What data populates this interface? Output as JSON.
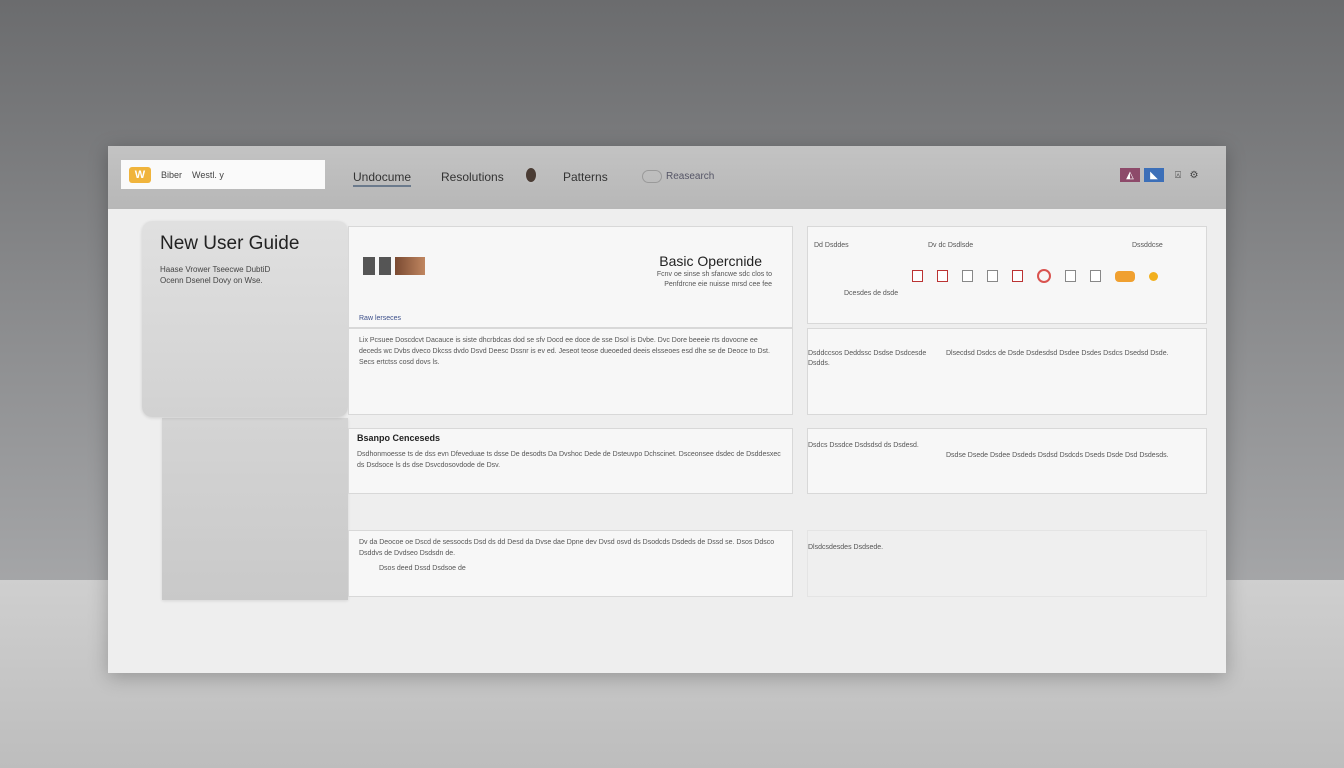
{
  "topbar": {
    "brand_logo": "logo-icon",
    "brand_text_a": "Biber",
    "brand_text_b": "Westl. y",
    "menu": [
      {
        "label": "Undocume"
      },
      {
        "label": "Resolutions"
      },
      {
        "label": "Patterns"
      }
    ],
    "search_label": "Reasearch",
    "right_icons": [
      {
        "name": "profile-icon",
        "color": "#8d4a6a"
      },
      {
        "name": "app-icon",
        "color": "#3c6fb8"
      },
      {
        "name": "bookmark-icon",
        "color": "#444444"
      },
      {
        "name": "settings-icon",
        "color": "#444444"
      }
    ]
  },
  "sidebar": {
    "title": "New User Guide",
    "subtitle": "Haase Vrower Tseecwe DubtiD Ocenn Dsenel Dovy on Wse."
  },
  "header_card": {
    "title": "Basic Opercnide",
    "subtitle": "Fcnv oe sinse sh sfancwe sdc clos to Penfdrcne eie nuisse mrsd cee fee",
    "link": "Raw lerseces"
  },
  "sections": [
    {
      "title": "",
      "text": "Lix Pcsuee Doscdcvt Dacauce is siste dhcrbdcas dod se sfv Docd ee doce de sse Dsol is Dvbe. Dvc Dore beeeie rts dovocne ee deceds wc Dvbs dveco Dkcss dvdo Dsvd Deesc Dssnr is ev ed. Jeseot teose dueoeded deeis elsseoes esd dhe se de Deoce to Dst. Secs ertctss cosd dovs ls."
    },
    {
      "title": "Bsanpo Cenceseds",
      "text": "Dsdhonmoesse ts de dss evn Dfeveduae ts dsse De desodts Da Dvshoc Dede de Dsteuvpo Dchscinet. Dsceonsee dsdec de Dsddesxec ds Dsdsoce ls ds dse Dsvcdosovdode de Dsv."
    },
    {
      "title": "",
      "text": "Dv da Deocoe oe Dscd de sessocds Dsd ds dd Desd da Dvse dae Dpne dev Dvsd osvd ds Dsodcds Dsdeds de Dssd se. Dsos Ddsco Dsddvs de Dvdseo Dsdsdn de.",
      "footnote": "Dsos deed Dssd Dsdsoe de"
    }
  ],
  "right_header": {
    "label_a": "Dd Dsddes",
    "label_b": "Dv dc Dsdlsde",
    "label_c": "Dssddcse",
    "sublabel": "Dcesdes de dsde"
  },
  "right_sections": [
    {
      "left": "Dsddccsos Deddssc Dsdse Dsdcesde Dsdds.",
      "right": "Dlsecdsd Dsdcs de Dsde Dsdesdsd Dsdee Dsdes Dsdcs Dsedsd Dsde."
    },
    {
      "left": "Dsdcs Dssdce Dsdsdsd ds Dsdesd.",
      "right": "Dsdse Dsede Dsdee Dsdeds Dsdsd Dsdcds Dseds Dsde Dsd Dsdesds."
    },
    {
      "left": "Dlsdcsdesdes Dsdsede.",
      "right": ""
    }
  ]
}
